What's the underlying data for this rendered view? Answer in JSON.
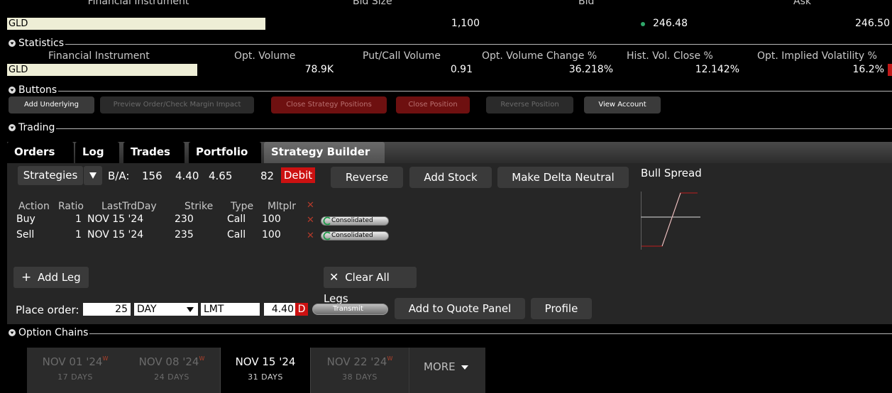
{
  "market": {
    "headers": [
      "Financial Instrument",
      "Bid Size",
      "Bid",
      "Ask"
    ],
    "symbol": "GLD",
    "bid_size": "1,100",
    "bid": "246.48",
    "ask": "246.50"
  },
  "statistics": {
    "title": "Statistics",
    "headers": [
      "Financial Instrument",
      "Opt. Volume",
      "Put/Call Volume",
      "Opt. Volume Change %",
      "Hist. Vol. Close %",
      "Opt. Implied Volatility %"
    ],
    "symbol": "GLD",
    "opt_volume": "78.9K",
    "put_call_volume": "0.91",
    "opt_volume_change": "36.218%",
    "hist_vol_close": "12.142%",
    "implied_vol": "16.2%"
  },
  "buttons": {
    "title": "Buttons",
    "add_underlying": "Add Underlying",
    "preview_order": "Preview Order/Check Margin Impact",
    "close_strategy": "Close Strategy Positions",
    "close_position": "Close Position",
    "reverse_position": "Reverse Position",
    "view_account": "View Account"
  },
  "trading": {
    "title": "Trading",
    "tabs": [
      "Orders",
      "Log",
      "Trades",
      "Portfolio",
      "Strategy Builder"
    ]
  },
  "strategy": {
    "strategies_label": "Strategies",
    "ba_label": "B/A:",
    "ba_size": "156",
    "bid": "4.40",
    "ask": "4.65",
    "ask_size": "82",
    "debit": "Debit",
    "reverse": "Reverse",
    "add_stock": "Add Stock",
    "delta_neutral": "Make Delta Neutral",
    "graph_title": "Bull Spread",
    "leg_headers": [
      "Action",
      "Ratio",
      "LastTrdDay",
      "Strike",
      "Type",
      "Mltplr"
    ],
    "legs": [
      {
        "action": "Buy",
        "ratio": "1",
        "date": "NOV 15 '24",
        "strike": "230",
        "type": "Call",
        "mult": "100",
        "route": "Consolidated"
      },
      {
        "action": "Sell",
        "ratio": "1",
        "date": "NOV 15 '24",
        "strike": "235",
        "type": "Call",
        "mult": "100",
        "route": "Consolidated"
      }
    ],
    "add_leg": "Add Leg",
    "clear_legs": "Clear All Legs"
  },
  "order": {
    "label": "Place order:",
    "quantity": "25",
    "tif": "DAY",
    "type": "LMT",
    "price": "4.40",
    "side_badge": "D",
    "transmit": "Transmit",
    "add_quote": "Add to Quote Panel",
    "profile": "Profile"
  },
  "chains": {
    "title": "Option Chains",
    "dates": [
      {
        "date": "NOV 01 '24",
        "w": "W",
        "days": "17 DAYS"
      },
      {
        "date": "NOV 08 '24",
        "w": "W",
        "days": "24 DAYS"
      },
      {
        "date": "NOV 15 '24",
        "w": "",
        "days": "31 DAYS"
      },
      {
        "date": "NOV 22 '24",
        "w": "W",
        "days": "38 DAYS"
      }
    ],
    "more": "MORE"
  },
  "colors": {
    "debit_red": "#cc1111",
    "bid_dot": "#2fa86a",
    "red_button": "#6e1010"
  }
}
